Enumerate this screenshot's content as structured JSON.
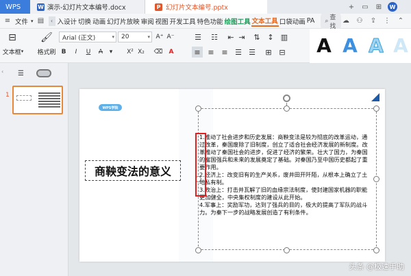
{
  "titlebar": {
    "app_tab": "WPS",
    "doc_tab": "演示-幻灯片文本编号.docx",
    "ppt_tab": "幻灯片文本编号.pptx",
    "w_badge": "W"
  },
  "menubar": {
    "file": "文件",
    "items": [
      "入设计",
      "切换",
      "动画",
      "幻灯片放映",
      "审阅",
      "视图",
      "开发工具",
      "特色功能"
    ],
    "drawing_tools": "绘图工具",
    "text_tools": "文本工具",
    "extra_items": [
      "口袋动画",
      "PA"
    ],
    "search": "查找"
  },
  "ribbon": {
    "textbox_label": "文本框",
    "format_painter": "格式刷",
    "font_name": "Arial (正文)",
    "font_size": "20",
    "bold": "B",
    "italic": "I",
    "underline": "U",
    "font_color": "A",
    "superscript": "X²",
    "subscript": "X₂",
    "increase_font": "A⁺",
    "decrease_font": "A⁻",
    "style_letter": "A"
  },
  "slide": {
    "badge": "WPS学院",
    "title": "商鞅变法的意义",
    "body": [
      "1.推动了社会进步和历史发展：商鞅变法是较为彻底的改革运动，通过改革，秦国废除了旧制度，创立了适合社会经济发展的新制度。改革推动了秦国社会的进步，促进了经济的繁荣。壮大了国力，为秦国的富国强兵和未来的发展奠定了基础。对秦国乃至中国历史都起了重要作用。",
      "2.经济上：改变旧有的生产关系，废井田开阡陌，从根本上确立了土地私有制。",
      "3.政治上：打击并瓦解了旧的血缘宗法制度，使封建国家机器的职能更加健全，中央集权制度的建设从此开始。",
      "4.军事上：奖励军功，达到了强兵的目的，极大的提高了军队的战斗力。为秦下一步的战略发展创造了有利条件。"
    ]
  },
  "thumbnail": {
    "slide_number": "1"
  },
  "watermark": "头条 @极速手助",
  "colors": {
    "accent_orange": "#e86a1e",
    "accent_green": "#1e9e5a",
    "wps_blue": "#3b7ddd",
    "highlight_red": "#e02020"
  }
}
